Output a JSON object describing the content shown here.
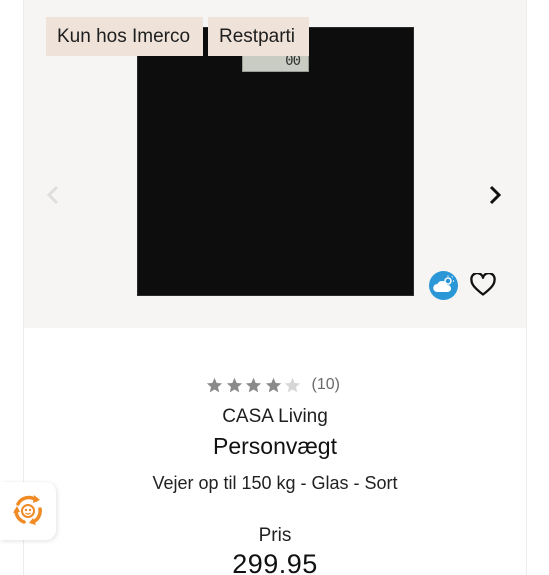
{
  "badges": {
    "exclusive": "Kun hos Imerco",
    "clearance": "Restparti"
  },
  "scale_display": "00",
  "rating": {
    "stars_filled": 4,
    "stars_total": 5,
    "count_text": "(10)"
  },
  "product": {
    "brand": "CASA Living",
    "title": "Personvægt",
    "subtitle": "Vejer op til 150 kg - Glas - Sort",
    "price_label": "Pris",
    "price": "299.95"
  },
  "icons": {
    "prev": "chevron-left-icon",
    "next": "chevron-right-icon",
    "cloud": "cloud-icon",
    "wishlist": "heart-icon",
    "recycle": "recycle-icon"
  },
  "colors": {
    "badge_bg": "#eee2d9",
    "image_bg": "#f7f5f3",
    "star_filled": "#8a8a8a",
    "star_empty": "#d6d6d6",
    "cloud_button": "#2b97d6",
    "recycle_accent": "#f08a24"
  }
}
